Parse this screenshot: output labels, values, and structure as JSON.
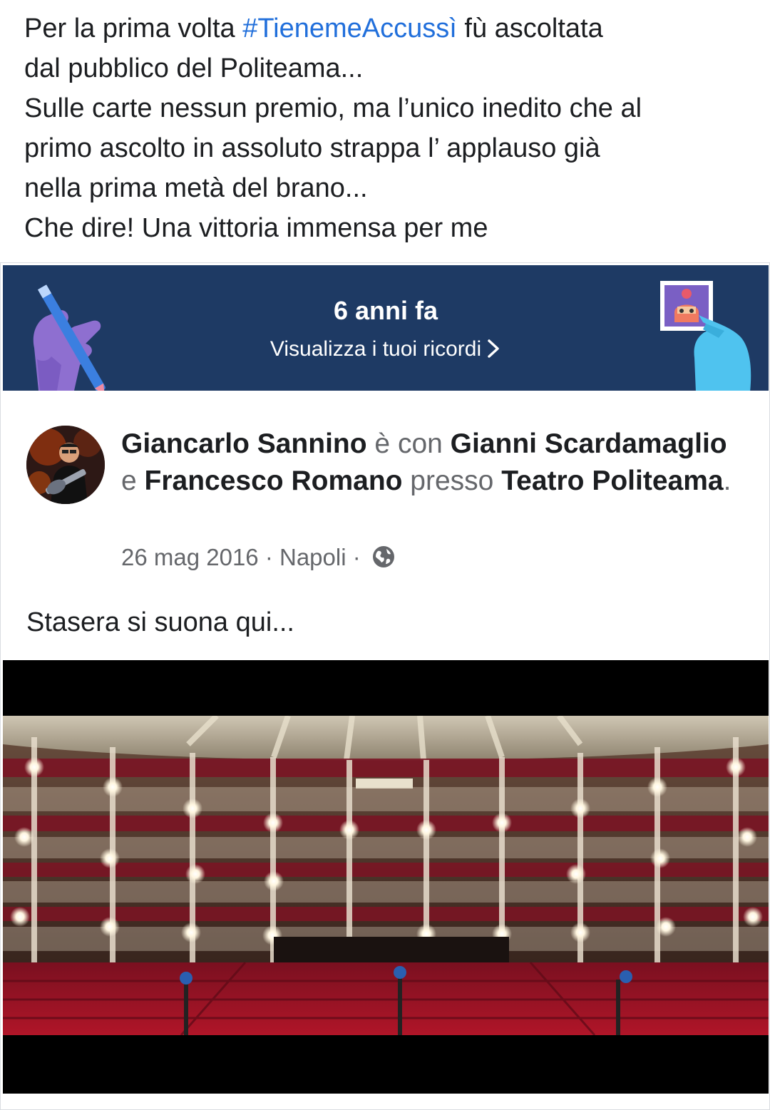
{
  "post": {
    "text_lines": [
      {
        "before": "Per la prima volta ",
        "hashtag": "#TienemeAccussì",
        "after": " fù ascoltata"
      },
      {
        "text": "dal pubblico del Politeama..."
      },
      {
        "text": "Sulle carte nessun premio, ma l’unico inedito che al"
      },
      {
        "text": "primo ascolto in assoluto strappa l’ applauso già"
      },
      {
        "text": "nella prima metà del brano..."
      },
      {
        "text": "Che dire! Una vittoria immensa per me"
      }
    ]
  },
  "memory": {
    "title": "6 anni fa",
    "link_label": "Visualizza i tuoi ricordi",
    "icons": [
      "pencil-hand-illustration",
      "photo-hand-illustration",
      "chevron-right-icon"
    ]
  },
  "original_post": {
    "author": "Giancarlo Sannino",
    "with_word": " è con ",
    "tagged_1": "Gianni Scardamaglio",
    "and_word": " e ",
    "tagged_2": "Francesco Romano",
    "at_word": " presso ",
    "place": "Teatro Politeama",
    "period": ".",
    "date": "26 mag 2016",
    "separator": " · ",
    "location": "Napoli",
    "privacy_icon": "globe-icon",
    "body": "Stasera si suona qui..."
  },
  "colors": {
    "text": "#1c1e21",
    "secondary": "#65676b",
    "hashtag": "#216fdb",
    "banner_bg": "#1e3a64",
    "photo_bg": "#000000"
  }
}
